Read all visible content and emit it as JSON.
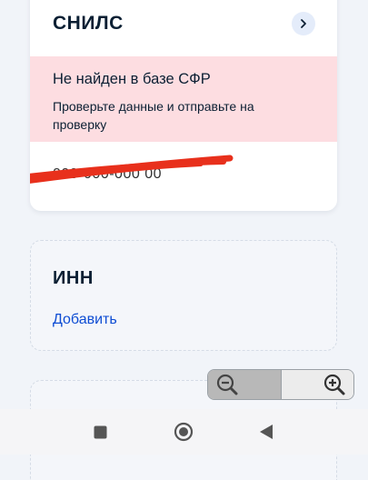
{
  "snils": {
    "title": "СНИЛС",
    "alert_title": "Не найден в базе СФР",
    "alert_text": "Проверьте данные и отправьте на проверку",
    "number": "000-000-000 00"
  },
  "inn": {
    "title": "ИНН",
    "add_label": "Добавить"
  },
  "colors": {
    "accent": "#0d4cd3",
    "alert_bg": "#fddde1",
    "redact": "#e8301c"
  },
  "icons": {
    "card_chevron": "chevron-right-icon",
    "zoom_out": "zoom-out-icon",
    "zoom_in": "zoom-in-icon",
    "nav_recent": "square-icon",
    "nav_home": "circle-icon",
    "nav_back": "triangle-back-icon"
  }
}
